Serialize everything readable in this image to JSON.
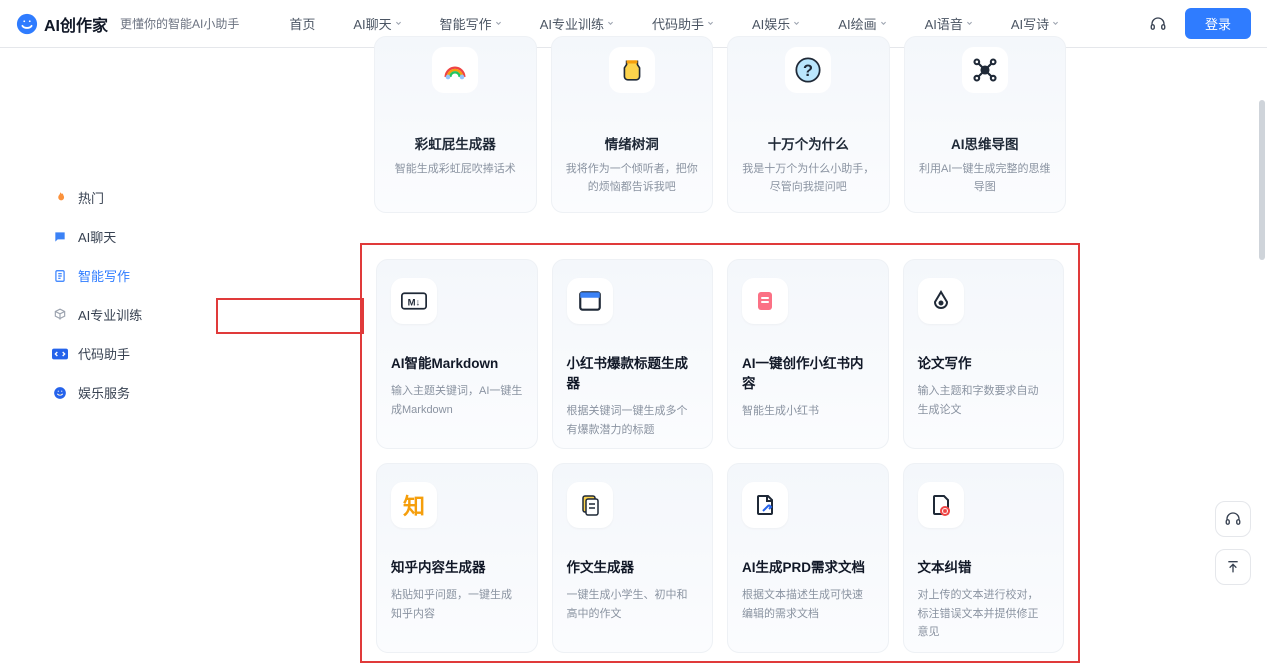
{
  "header": {
    "brand": "AI创作家",
    "tagline": "更懂你的智能AI小助手",
    "nav": [
      {
        "label": "首页",
        "dropdown": false
      },
      {
        "label": "AI聊天",
        "dropdown": true
      },
      {
        "label": "智能写作",
        "dropdown": true
      },
      {
        "label": "AI专业训练",
        "dropdown": true
      },
      {
        "label": "代码助手",
        "dropdown": true
      },
      {
        "label": "AI娱乐",
        "dropdown": true
      },
      {
        "label": "AI绘画",
        "dropdown": true
      },
      {
        "label": "AI语音",
        "dropdown": true
      },
      {
        "label": "AI写诗",
        "dropdown": true
      }
    ],
    "login": "登录"
  },
  "sidebar": {
    "items": [
      {
        "icon": "fire",
        "label": "热门",
        "color": "#f97316"
      },
      {
        "icon": "chat",
        "label": "AI聊天",
        "color": "#3b82f6"
      },
      {
        "icon": "doc",
        "label": "智能写作",
        "color": "#2f7cff",
        "active": true
      },
      {
        "icon": "train",
        "label": "AI专业训练",
        "color": "#6b7280"
      },
      {
        "icon": "code",
        "label": "代码助手",
        "color": "#2563eb"
      },
      {
        "icon": "smile",
        "label": "娱乐服务",
        "color": "#2563eb"
      }
    ]
  },
  "top_cards": [
    {
      "icon": "rainbow",
      "title": "彩虹屁生成器",
      "desc": "智能生成彩虹屁吹捧话术"
    },
    {
      "icon": "jar",
      "title": "情绪树洞",
      "desc": "我将作为一个倾听者，把你的烦恼都告诉我吧"
    },
    {
      "icon": "question",
      "title": "十万个为什么",
      "desc": "我是十万个为什么小助手，尽管向我提问吧"
    },
    {
      "icon": "mindmap",
      "title": "AI思维导图",
      "desc": "利用AI一键生成完整的思维导图"
    }
  ],
  "grid_cards": [
    {
      "icon": "md",
      "title": "AI智能Markdown",
      "desc": "输入主题关键词，AI一键生成Markdown"
    },
    {
      "icon": "window",
      "title": "小红书爆款标题生成器",
      "desc": "根据关键词一键生成多个有爆款潜力的标题"
    },
    {
      "icon": "note",
      "title": "AI一键创作小红书内容",
      "desc": "智能生成小红书"
    },
    {
      "icon": "pen",
      "title": "论文写作",
      "desc": "输入主题和字数要求自动生成论文"
    },
    {
      "icon": "zhi",
      "title": "知乎内容生成器",
      "desc": "粘贴知乎问题，一键生成知乎内容"
    },
    {
      "icon": "essay",
      "title": "作文生成器",
      "desc": "一键生成小学生、初中和高中的作文"
    },
    {
      "icon": "prd",
      "title": "AI生成PRD需求文档",
      "desc": "根据文本描述生成可快速编辑的需求文档"
    },
    {
      "icon": "fix",
      "title": "文本纠错",
      "desc": "对上传的文本进行校对，标注错误文本并提供修正意见"
    }
  ]
}
